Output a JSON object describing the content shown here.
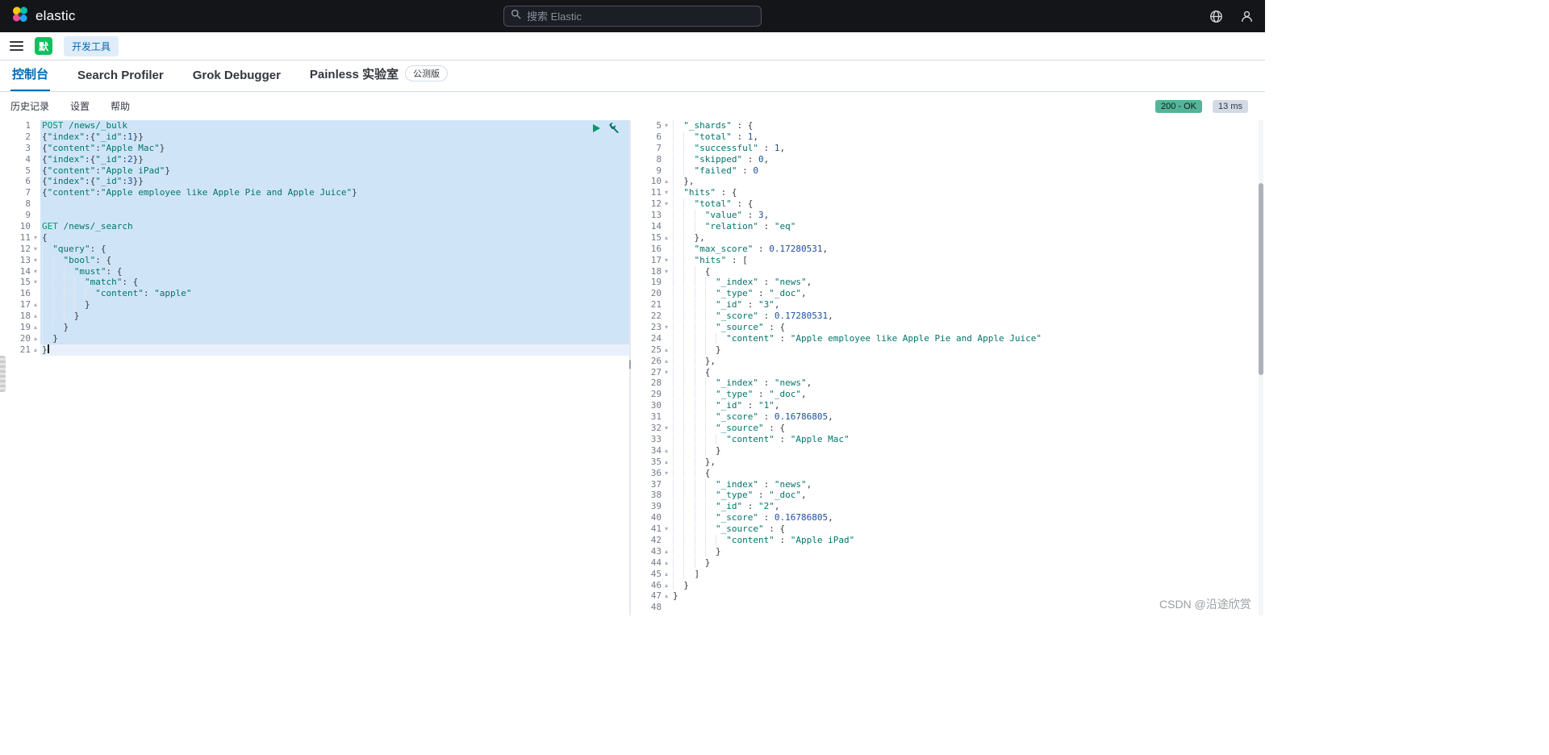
{
  "header": {
    "brand": "elastic",
    "search_placeholder": "搜索 Elastic"
  },
  "nav": {
    "space_initial": "默",
    "breadcrumb": "开发工具"
  },
  "tabs": [
    {
      "label": "控制台",
      "active": true
    },
    {
      "label": "Search Profiler"
    },
    {
      "label": "Grok Debugger"
    },
    {
      "label": "Painless 实验室",
      "badge": "公测版"
    }
  ],
  "toolbar": {
    "history": "历史记录",
    "settings": "设置",
    "help": "帮助",
    "status_badge": "200 - OK",
    "time_badge": "13 ms"
  },
  "colors": {
    "accent": "#006bb4",
    "status_success": "#54b399",
    "time_badge_bg": "#d3dae6",
    "selection": "#d0e4f7",
    "space_badge": "#12bf5f",
    "header_bg": "#141519"
  },
  "editor": {
    "lines": [
      {
        "n": 1,
        "fold": "",
        "sel": true,
        "text": "POST /news/_bulk"
      },
      {
        "n": 2,
        "fold": "",
        "sel": true,
        "text": "{\"index\":{\"_id\":1}}"
      },
      {
        "n": 3,
        "fold": "",
        "sel": true,
        "text": "{\"content\":\"Apple Mac\"}"
      },
      {
        "n": 4,
        "fold": "",
        "sel": true,
        "text": "{\"index\":{\"_id\":2}}"
      },
      {
        "n": 5,
        "fold": "",
        "sel": true,
        "text": "{\"content\":\"Apple iPad\"}"
      },
      {
        "n": 6,
        "fold": "",
        "sel": true,
        "text": "{\"index\":{\"_id\":3}}"
      },
      {
        "n": 7,
        "fold": "",
        "sel": true,
        "text": "{\"content\":\"Apple employee like Apple Pie and Apple Juice\"}"
      },
      {
        "n": 8,
        "fold": "",
        "sel": true,
        "text": ""
      },
      {
        "n": 9,
        "fold": "",
        "sel": true,
        "text": ""
      },
      {
        "n": 10,
        "fold": "",
        "sel": true,
        "text": "GET /news/_search"
      },
      {
        "n": 11,
        "fold": "v",
        "sel": true,
        "text": "{"
      },
      {
        "n": 12,
        "fold": "v",
        "sel": true,
        "text": "  \"query\": {"
      },
      {
        "n": 13,
        "fold": "v",
        "sel": true,
        "text": "    \"bool\": {"
      },
      {
        "n": 14,
        "fold": "v",
        "sel": true,
        "text": "      \"must\": {"
      },
      {
        "n": 15,
        "fold": "v",
        "sel": true,
        "text": "        \"match\": {"
      },
      {
        "n": 16,
        "fold": "",
        "sel": true,
        "text": "          \"content\": \"apple\""
      },
      {
        "n": 17,
        "fold": "e",
        "sel": true,
        "text": "        }"
      },
      {
        "n": 18,
        "fold": "e",
        "sel": true,
        "text": "      }"
      },
      {
        "n": 19,
        "fold": "e",
        "sel": true,
        "text": "    }"
      },
      {
        "n": 20,
        "fold": "e",
        "sel": true,
        "text": "  }"
      },
      {
        "n": 21,
        "fold": "e",
        "active": true,
        "cursor": true,
        "text": "}"
      }
    ]
  },
  "response": {
    "lines": [
      {
        "n": 5,
        "fold": "v",
        "text": "  \"_shards\" : {"
      },
      {
        "n": 6,
        "fold": "",
        "text": "    \"total\" : 1,"
      },
      {
        "n": 7,
        "fold": "",
        "text": "    \"successful\" : 1,"
      },
      {
        "n": 8,
        "fold": "",
        "text": "    \"skipped\" : 0,"
      },
      {
        "n": 9,
        "fold": "",
        "text": "    \"failed\" : 0"
      },
      {
        "n": 10,
        "fold": "e",
        "text": "  },"
      },
      {
        "n": 11,
        "fold": "v",
        "text": "  \"hits\" : {"
      },
      {
        "n": 12,
        "fold": "v",
        "text": "    \"total\" : {"
      },
      {
        "n": 13,
        "fold": "",
        "text": "      \"value\" : 3,"
      },
      {
        "n": 14,
        "fold": "",
        "text": "      \"relation\" : \"eq\""
      },
      {
        "n": 15,
        "fold": "e",
        "text": "    },"
      },
      {
        "n": 16,
        "fold": "",
        "text": "    \"max_score\" : 0.17280531,"
      },
      {
        "n": 17,
        "fold": "v",
        "text": "    \"hits\" : ["
      },
      {
        "n": 18,
        "fold": "v",
        "text": "      {"
      },
      {
        "n": 19,
        "fold": "",
        "text": "        \"_index\" : \"news\","
      },
      {
        "n": 20,
        "fold": "",
        "text": "        \"_type\" : \"_doc\","
      },
      {
        "n": 21,
        "fold": "",
        "text": "        \"_id\" : \"3\","
      },
      {
        "n": 22,
        "fold": "",
        "text": "        \"_score\" : 0.17280531,"
      },
      {
        "n": 23,
        "fold": "v",
        "text": "        \"_source\" : {"
      },
      {
        "n": 24,
        "fold": "",
        "text": "          \"content\" : \"Apple employee like Apple Pie and Apple Juice\""
      },
      {
        "n": 25,
        "fold": "e",
        "text": "        }"
      },
      {
        "n": 26,
        "fold": "e",
        "text": "      },"
      },
      {
        "n": 27,
        "fold": "v",
        "text": "      {"
      },
      {
        "n": 28,
        "fold": "",
        "text": "        \"_index\" : \"news\","
      },
      {
        "n": 29,
        "fold": "",
        "text": "        \"_type\" : \"_doc\","
      },
      {
        "n": 30,
        "fold": "",
        "text": "        \"_id\" : \"1\","
      },
      {
        "n": 31,
        "fold": "",
        "text": "        \"_score\" : 0.16786805,"
      },
      {
        "n": 32,
        "fold": "v",
        "text": "        \"_source\" : {"
      },
      {
        "n": 33,
        "fold": "",
        "text": "          \"content\" : \"Apple Mac\""
      },
      {
        "n": 34,
        "fold": "e",
        "text": "        }"
      },
      {
        "n": 35,
        "fold": "e",
        "text": "      },"
      },
      {
        "n": 36,
        "fold": "v",
        "text": "      {"
      },
      {
        "n": 37,
        "fold": "",
        "text": "        \"_index\" : \"news\","
      },
      {
        "n": 38,
        "fold": "",
        "text": "        \"_type\" : \"_doc\","
      },
      {
        "n": 39,
        "fold": "",
        "text": "        \"_id\" : \"2\","
      },
      {
        "n": 40,
        "fold": "",
        "text": "        \"_score\" : 0.16786805,"
      },
      {
        "n": 41,
        "fold": "v",
        "text": "        \"_source\" : {"
      },
      {
        "n": 42,
        "fold": "",
        "text": "          \"content\" : \"Apple iPad\""
      },
      {
        "n": 43,
        "fold": "e",
        "text": "        }"
      },
      {
        "n": 44,
        "fold": "e",
        "text": "      }"
      },
      {
        "n": 45,
        "fold": "e",
        "text": "    ]"
      },
      {
        "n": 46,
        "fold": "e",
        "text": "  }"
      },
      {
        "n": 47,
        "fold": "e",
        "text": "}"
      },
      {
        "n": 48,
        "fold": "",
        "text": ""
      }
    ]
  },
  "watermark": "CSDN @沿途欣赏"
}
